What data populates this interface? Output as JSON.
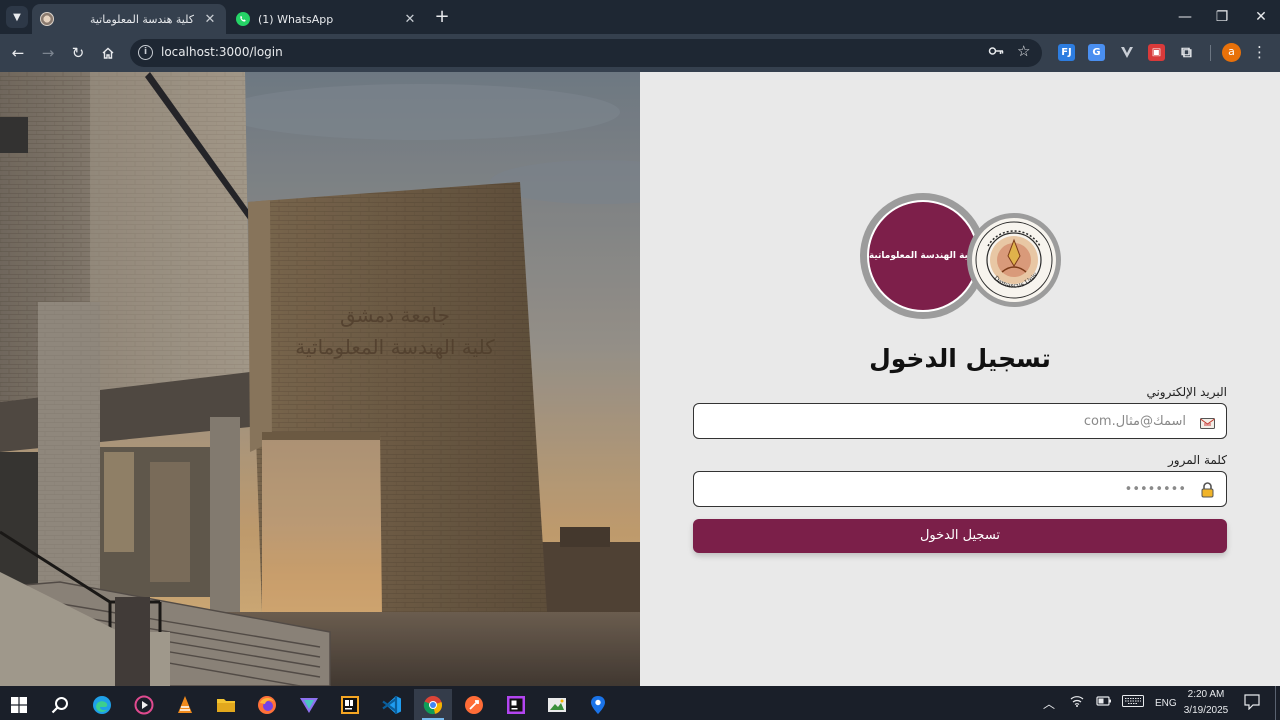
{
  "browser": {
    "tabs": [
      {
        "title": "كلية هندسة المعلوماتية",
        "active": true,
        "favicon": "faculty-logo-icon"
      },
      {
        "title": "(1) WhatsApp",
        "active": false,
        "favicon": "whatsapp-icon"
      }
    ],
    "new_tab_label": "+",
    "url": "localhost:3000/login",
    "profile_initial": "a",
    "extensions": [
      "translate-ext-icon",
      "dictionary-ext-icon",
      "vpn-ext-icon",
      "gift-ext-icon",
      "puzzle-extensions-icon"
    ]
  },
  "page": {
    "logo_faculty_text": "كلية الهندسة المعلوماتية",
    "logo_university_text": "Damascus University",
    "title": "تسجيل الدخول",
    "email": {
      "label": "البريد الإلكتروني",
      "placeholder": "اسمك@مثال.com",
      "value": "",
      "icon": "envelope-icon"
    },
    "password": {
      "label": "كلمة المرور",
      "placeholder": "••••••••",
      "value": "",
      "icon": "lock-icon"
    },
    "submit_label": "تسجيل الدخول"
  },
  "taskbar": {
    "apps": [
      "start-icon",
      "search-icon",
      "edge-icon",
      "media-player-icon",
      "vlc-icon",
      "file-explorer-icon",
      "firefox-icon",
      "proton-vpn-icon",
      "jetbrains-toolbox-icon",
      "vscode-icon",
      "chrome-icon",
      "postman-icon",
      "phpstorm-icon",
      "snipping-tool-icon",
      "maps-icon"
    ],
    "language": "ENG",
    "time": "2:20 AM",
    "date": "3/19/2025"
  },
  "colors": {
    "brand": "#7b1f49",
    "panel_bg": "#e9e9e9",
    "chrome_dark": "#1e2733",
    "chrome_toolbar": "#35404e"
  }
}
